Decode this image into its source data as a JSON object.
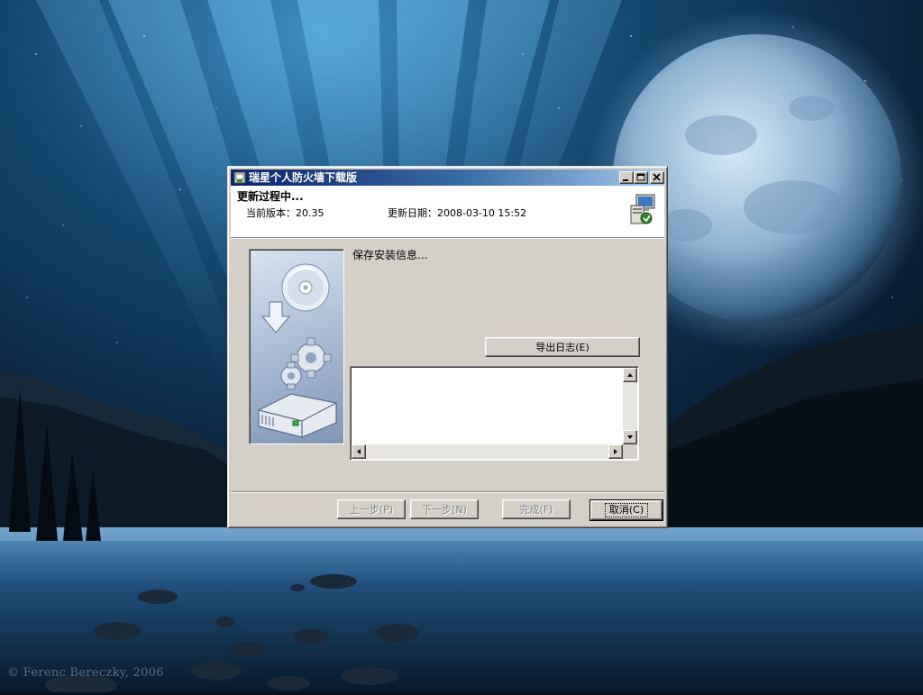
{
  "window": {
    "title": "瑞星个人防火墙下载版"
  },
  "header": {
    "title": "更新过程中...",
    "version_label": "当前版本：20.35",
    "date_label": "更新日期：2008-03-10 15:52"
  },
  "status": {
    "text": "保存安装信息..."
  },
  "buttons": {
    "export_log": "导出日志(E)",
    "prev": "上一步(P)",
    "next": "下一步(N)",
    "finish": "完成(F)",
    "cancel": "取消(C)"
  },
  "button_states": {
    "prev_enabled": false,
    "next_enabled": false,
    "finish_enabled": false,
    "cancel_default": true
  },
  "wallpaper": {
    "credit": "© Ferenc Bereczky, 2006"
  },
  "icons": {
    "title": "rising-firewall-icon",
    "header": "computer-update-icon",
    "side": "install-cd-gears-icon"
  },
  "colors": {
    "titlebar_start": "#0a246a",
    "titlebar_end": "#a6caf0",
    "dialog_face": "#d4d0c8"
  }
}
